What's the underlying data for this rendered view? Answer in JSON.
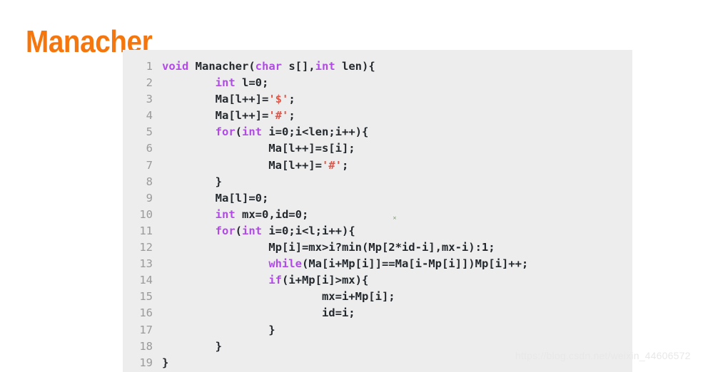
{
  "slide": {
    "title": "Manacher",
    "title_color": "#f4760d",
    "background_color": "#ffffff"
  },
  "code_panel": {
    "background_color": "#ededed",
    "language": "C++",
    "gutter_color": "#9a9a9a",
    "text_color": "#24292e",
    "keyword_color": "#b14ae8",
    "string_color": "#e0574a",
    "line_count": 19,
    "lines": [
      {
        "number": "1",
        "tokens": [
          {
            "t": "kw",
            "v": "void"
          },
          {
            "t": "src",
            "v": " Manacher("
          },
          {
            "t": "kw",
            "v": "char"
          },
          {
            "t": "src",
            "v": " s[],"
          },
          {
            "t": "kw",
            "v": "int"
          },
          {
            "t": "src",
            "v": " len){"
          }
        ]
      },
      {
        "number": "2",
        "tokens": [
          {
            "t": "src",
            "v": "        "
          },
          {
            "t": "kw",
            "v": "int"
          },
          {
            "t": "src",
            "v": " l=0;"
          }
        ]
      },
      {
        "number": "3",
        "tokens": [
          {
            "t": "src",
            "v": "        Ma[l++]="
          },
          {
            "t": "str",
            "v": "'$'"
          },
          {
            "t": "src",
            "v": ";"
          }
        ]
      },
      {
        "number": "4",
        "tokens": [
          {
            "t": "src",
            "v": "        Ma[l++]="
          },
          {
            "t": "str",
            "v": "'#'"
          },
          {
            "t": "src",
            "v": ";"
          }
        ]
      },
      {
        "number": "5",
        "tokens": [
          {
            "t": "src",
            "v": "        "
          },
          {
            "t": "kw",
            "v": "for"
          },
          {
            "t": "src",
            "v": "("
          },
          {
            "t": "kw",
            "v": "int"
          },
          {
            "t": "src",
            "v": " i=0;i<len;i++){"
          }
        ]
      },
      {
        "number": "6",
        "tokens": [
          {
            "t": "src",
            "v": "                Ma[l++]=s[i];"
          }
        ]
      },
      {
        "number": "7",
        "tokens": [
          {
            "t": "src",
            "v": "                Ma[l++]="
          },
          {
            "t": "str",
            "v": "'#'"
          },
          {
            "t": "src",
            "v": ";"
          }
        ]
      },
      {
        "number": "8",
        "tokens": [
          {
            "t": "src",
            "v": "        }"
          }
        ]
      },
      {
        "number": "9",
        "tokens": [
          {
            "t": "src",
            "v": "        Ma[l]=0;"
          }
        ]
      },
      {
        "number": "10",
        "tokens": [
          {
            "t": "src",
            "v": "        "
          },
          {
            "t": "kw",
            "v": "int"
          },
          {
            "t": "src",
            "v": " mx=0,id=0;"
          }
        ]
      },
      {
        "number": "11",
        "tokens": [
          {
            "t": "src",
            "v": "        "
          },
          {
            "t": "kw",
            "v": "for"
          },
          {
            "t": "src",
            "v": "("
          },
          {
            "t": "kw",
            "v": "int"
          },
          {
            "t": "src",
            "v": " i=0;i<l;i++){"
          }
        ]
      },
      {
        "number": "12",
        "tokens": [
          {
            "t": "src",
            "v": "                Mp[i]=mx>i?min(Mp[2*id-i],mx-i):1;"
          }
        ]
      },
      {
        "number": "13",
        "tokens": [
          {
            "t": "src",
            "v": "                "
          },
          {
            "t": "kw",
            "v": "while"
          },
          {
            "t": "src",
            "v": "(Ma[i+Mp[i]]==Ma[i-Mp[i]])Mp[i]++;"
          }
        ]
      },
      {
        "number": "14",
        "tokens": [
          {
            "t": "src",
            "v": "                "
          },
          {
            "t": "kw",
            "v": "if"
          },
          {
            "t": "src",
            "v": "(i+Mp[i]>mx){"
          }
        ]
      },
      {
        "number": "15",
        "tokens": [
          {
            "t": "src",
            "v": "                        mx=i+Mp[i];"
          }
        ]
      },
      {
        "number": "16",
        "tokens": [
          {
            "t": "src",
            "v": "                        id=i;"
          }
        ]
      },
      {
        "number": "17",
        "tokens": [
          {
            "t": "src",
            "v": "                }"
          }
        ]
      },
      {
        "number": "18",
        "tokens": [
          {
            "t": "src",
            "v": "        }"
          }
        ]
      },
      {
        "number": "19",
        "tokens": [
          {
            "t": "src",
            "v": "}"
          }
        ]
      }
    ]
  },
  "watermark": {
    "text": "https://blog.csdn.net/weixin_44606572",
    "color": "#e8e8e8"
  },
  "cursor_artifact": {
    "glyph": "×"
  }
}
